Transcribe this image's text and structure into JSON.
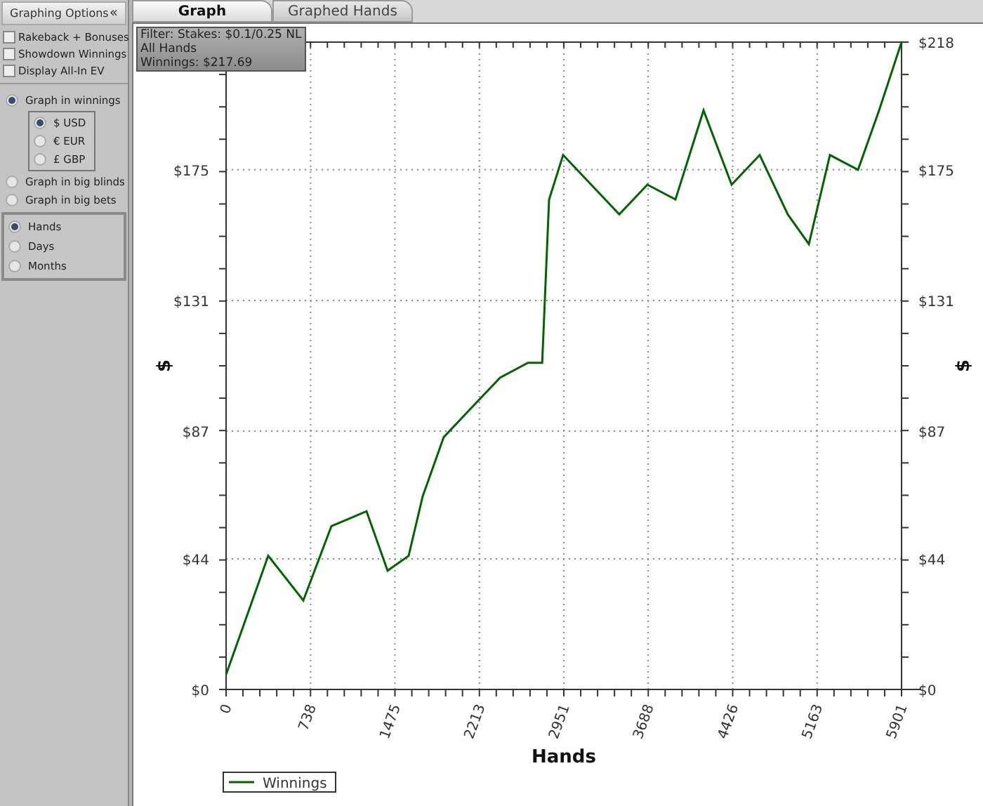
{
  "sidebar": {
    "title": "Graphing Options",
    "collapse_glyph": "«",
    "checkboxes": [
      {
        "label": "Rakeback + Bonuses",
        "checked": false
      },
      {
        "label": "Showdown Winnings",
        "checked": false
      },
      {
        "label": "Display All-In EV",
        "checked": false
      }
    ],
    "graph_modes": [
      {
        "label": "Graph in winnings",
        "selected": true,
        "children": [
          {
            "label": "$ USD",
            "selected": true
          },
          {
            "label": "€ EUR",
            "selected": false
          },
          {
            "label": "£ GBP",
            "selected": false
          }
        ]
      },
      {
        "label": "Graph in big blinds",
        "selected": false
      },
      {
        "label": "Graph in big bets",
        "selected": false
      }
    ],
    "x_axis_options": [
      {
        "label": "Hands",
        "selected": true
      },
      {
        "label": "Days",
        "selected": false
      },
      {
        "label": "Months",
        "selected": false
      }
    ]
  },
  "tabs": [
    {
      "label": "Graph",
      "selected": true
    },
    {
      "label": "Graphed Hands",
      "selected": false
    }
  ],
  "filter_box": [
    "Filter: Stakes: $0.1/0.25 NL",
    "All Hands",
    "Winnings: $217.69"
  ],
  "chart_data": {
    "type": "line",
    "grid": true,
    "xlabel": "Hands",
    "ylabel": "$",
    "ylim": [
      0,
      218
    ],
    "xlim": [
      0,
      5901
    ],
    "yticks": [
      {
        "value": 0,
        "label": "$0"
      },
      {
        "value": 44,
        "label": "$44"
      },
      {
        "value": 87,
        "label": "$87"
      },
      {
        "value": 131,
        "label": "$131"
      },
      {
        "value": 175,
        "label": "$175"
      },
      {
        "value": 218,
        "label": "$218"
      }
    ],
    "xticks": [
      0,
      738,
      1475,
      2213,
      2951,
      3688,
      4426,
      5163,
      5901
    ],
    "x": [
      0,
      184,
      368,
      675,
      920,
      1227,
      1411,
      1595,
      1718,
      1902,
      2147,
      2393,
      2638,
      2761,
      2822,
      2944,
      3190,
      3435,
      3681,
      3926,
      4171,
      4417,
      4662,
      4907,
      5091,
      5275,
      5521,
      5705,
      5901
    ],
    "series": [
      {
        "name": "Winnings",
        "color": "#006400",
        "values": [
          5,
          25,
          45,
          30,
          55,
          60,
          40,
          45,
          65,
          85,
          95,
          105,
          110,
          110,
          165,
          180,
          170,
          160,
          170,
          165,
          195,
          170,
          180,
          160,
          150,
          180,
          175,
          195,
          218
        ]
      }
    ]
  }
}
